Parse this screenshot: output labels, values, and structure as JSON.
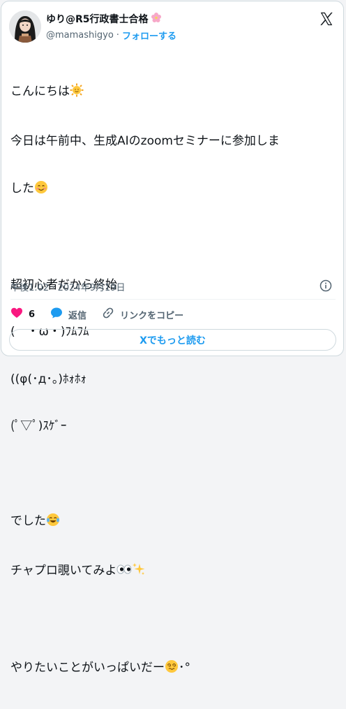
{
  "author": {
    "name": "ゆり@R5行政書士合格",
    "handle": "@mamashigyo",
    "separator": "·",
    "follow_label": "フォローする"
  },
  "tweet": {
    "line1": "こんにちは",
    "line2": "今日は午前中、生成AIのzoomセミナーに参加しま",
    "line3": "した",
    "line4": "超初心者だから終始",
    "line5": "(　・ω・)ﾌﾑﾌﾑ",
    "line6": "((φ(･д･。)ﾎｫﾎｫ",
    "line7": "(ﾟ▽ﾟ)ｽｹﾞｰ",
    "line8": "でした",
    "line9": "チャプロ覗いてみよ",
    "line10": "やりたいことがいっぱいだー",
    "line10_suffix": "･°"
  },
  "meta": {
    "timestamp": "午後1:02 · 2024年9月19日"
  },
  "actions": {
    "like_count": "6",
    "reply_label": "返信",
    "copy_label": "リンクをコピー"
  },
  "read_more_label": "Xでもっと読む",
  "colors": {
    "accent": "#1d9bf0",
    "like": "#f91880",
    "text": "#0f1419",
    "muted": "#536471"
  },
  "icons": [
    "x-logo-icon",
    "sakura-icon",
    "sun-face-icon",
    "smile-icon",
    "tears-of-joy-icon",
    "eyes-icon",
    "sparkles-icon",
    "dizzy-face-icon",
    "info-icon",
    "heart-icon",
    "reply-icon",
    "link-icon"
  ]
}
